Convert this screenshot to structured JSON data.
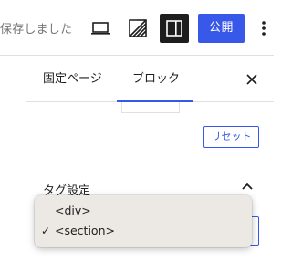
{
  "toolbar": {
    "saved_status": "保存しました",
    "publish_label": "公開",
    "icons": [
      "laptop-icon",
      "style-icon",
      "sidebar-toggle-icon",
      "more-options-icon"
    ],
    "accent_color": "#3858e9"
  },
  "sidebar": {
    "tabs": [
      {
        "label": "固定ページ",
        "active": false
      },
      {
        "label": "ブロック",
        "active": true
      }
    ],
    "reset_label": "リセット",
    "tag_settings": {
      "title": "タグ設定",
      "expanded": true
    }
  },
  "dropdown": {
    "options": [
      {
        "label": "<div>",
        "checked": false
      },
      {
        "label": "<section>",
        "checked": true
      }
    ],
    "selected": "<section>",
    "check_symbol": "✓"
  }
}
